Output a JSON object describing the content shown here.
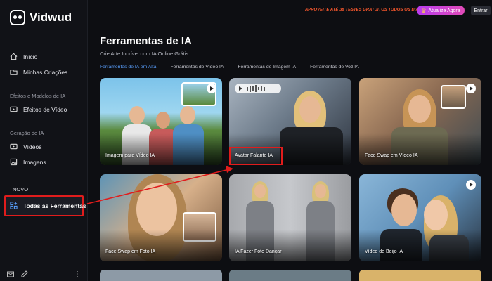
{
  "app": {
    "name": "Vidwud"
  },
  "topbar": {
    "promo_text": "APROVEITE ATÉ 38 TESTES GRATUITOS TODOS OS DIAS!",
    "upgrade_label": "Atualize Agora",
    "login_label": "Entrar"
  },
  "sidebar": {
    "items": [
      {
        "label": "Início",
        "icon": "home-icon"
      },
      {
        "label": "Minhas Criações",
        "icon": "folder-icon"
      }
    ],
    "section_effects": "Efeitos e Modelos de IA",
    "effects_item": "Efeitos de Vídeo",
    "section_generation": "Geração de IA",
    "generation_items": [
      {
        "label": "Vídeos",
        "icon": "video-icon"
      },
      {
        "label": "Imagens",
        "icon": "image-icon"
      }
    ],
    "new_label": "NOVO",
    "all_tools": "Todas as Ferramentas"
  },
  "main": {
    "title": "Ferramentas de IA",
    "subtitle": "Crie Arte Incrível com IA Online Grátis",
    "tabs": [
      {
        "label": "Ferramentas de IA em Alta",
        "active": true
      },
      {
        "label": "Ferramentas de Vídeo IA",
        "active": false
      },
      {
        "label": "Ferramentas de Imagem IA",
        "active": false
      },
      {
        "label": "Ferramentas de Voz IA",
        "active": false
      }
    ],
    "cards": [
      {
        "label": "Imagem para Vídeo IA"
      },
      {
        "label": "Avatar Falante IA"
      },
      {
        "label": "Face Swap em Vídeo IA"
      },
      {
        "label": "Face Swap em Foto IA"
      },
      {
        "label": "IA Fazer Foto Dançar"
      },
      {
        "label": "Vídeo de Beijo IA"
      }
    ]
  },
  "colors": {
    "accent": "#5aa0ff",
    "highlight": "#e11c1c",
    "upgrade_start": "#b83cf0",
    "upgrade_end": "#e14ab8"
  }
}
